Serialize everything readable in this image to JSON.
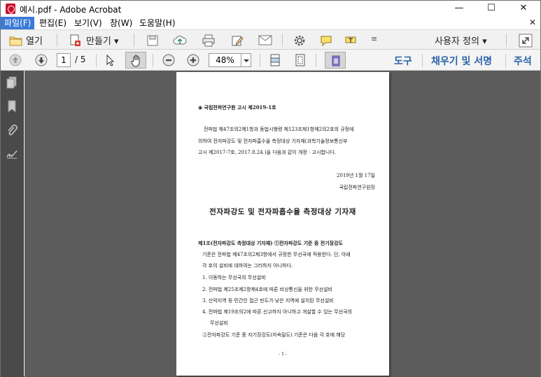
{
  "window": {
    "title": "예시.pdf - Adobe Acrobat",
    "min_glyph": "—",
    "max_glyph": "☐",
    "close_glyph": "✕"
  },
  "menu": {
    "items": [
      "파일(F)",
      "편집(E)",
      "보기(V)",
      "창(W)",
      "도움말(H)"
    ],
    "close_glyph": "✕"
  },
  "toolbar": {
    "open_label": "열기",
    "create_label": "만들기 ▾",
    "customize_label": "사용자 정의 ▾",
    "page_current": "1",
    "page_total": "/ 5",
    "zoom_value": "48%",
    "right_tools": [
      "도구",
      "채우기 및 서명",
      "주석"
    ]
  },
  "colors": {
    "accent": "#3a7bd5",
    "right_tool_text": "#2a63a8",
    "sidebar": "#4a4a4a",
    "doc_background": "#5c5c5c"
  },
  "icons": [
    "pdf-app-icon",
    "folder-icon",
    "create-pdf-icon",
    "save-icon",
    "cloud-upload-icon",
    "print-icon",
    "edit-icon",
    "email-icon",
    "gear-icon",
    "comment-icon",
    "highlight-icon",
    "more-icon",
    "expand-icon",
    "page-up-icon",
    "page-down-icon",
    "select-arrow-icon",
    "hand-icon",
    "zoom-out-icon",
    "zoom-in-icon",
    "fit-width-icon",
    "fit-page-icon",
    "read-mode-icon",
    "pages-panel-icon",
    "bookmark-icon",
    "attachment-icon",
    "signature-icon"
  ],
  "document": {
    "header_line": "◉ 국립전파연구원 고시 제2019-1호",
    "intro_lines": [
      "전파법 제47조의2제1항과 동법시행령 제123조제1항제2의2호의 규정에",
      "의하여 전자파강도 및 전자파흡수율 측정대상 기자재(과학기술정보통신부",
      "고시 제2017-7호, 2017.8.24.)을 다음과 같이 개정 · 고시합니다."
    ],
    "date": "2019년  1월  17일",
    "issuer": "국립전파연구원장",
    "title": "전자파강도 및 전자파흡수율 측정대상 기자재",
    "article_lines": [
      "제1조(전자파강도 측정대상 기자재) ①전자파강도 기준 중 전기장강도",
      "기준은 전파법 제47조의2제3항에서 규정한 무선국에 적용한다. 단, 아래",
      "각 호의 설비에 대하여는 그러하지 아니하다."
    ],
    "list_items": [
      "1. 이동하는 무선국의 무선설비",
      "2. 전파법 제25조제2항제4호에 따른 비상통신을 위한 무선설비",
      "3. 산악지역 등 민간인 접근 빈도가 낮은 지역에 설치된 무선설비",
      "4. 전파법 제19조의2에 따른 신고하지 아니하고 개설할 수 있는 무선국의",
      "무선설비"
    ],
    "last_line": "②전자파강도 기준 중 자기장강도(자속밀도) 기준은 다음 각 호에 해당",
    "page_number": "- 1 -"
  }
}
